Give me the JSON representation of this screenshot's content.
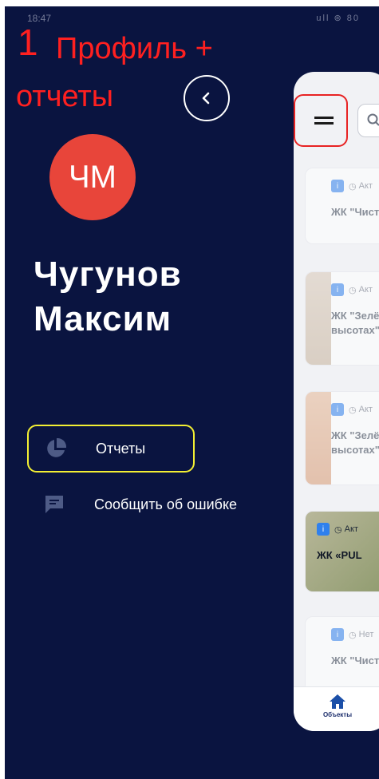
{
  "status_bar": {
    "time": "18:47",
    "icons_text": "ull ⊛ 80"
  },
  "annotation": {
    "number": "1",
    "line1": "Профиль +",
    "line2": "отчеты"
  },
  "profile": {
    "initials": "ЧМ",
    "name": "Чугунов Максим",
    "avatar_color": "#e8453a"
  },
  "menu": {
    "reports_label": "Отчеты",
    "report_bug_label": "Сообщить об ошибке"
  },
  "panel": {
    "cards": [
      {
        "status": "Акт",
        "title": "ЖК \"Чист"
      },
      {
        "status": "Акт",
        "title": "ЖК \"Зелё",
        "title2": "высотах\""
      },
      {
        "status": "Акт",
        "title": "ЖК \"Зелё",
        "title2": "высотах\""
      },
      {
        "status": "Акт",
        "title": "ЖК «PUL"
      },
      {
        "status": "Нет",
        "title": "ЖК \"Чист"
      }
    ],
    "tab_objects_label": "Объекты"
  },
  "colors": {
    "background": "#0a1440",
    "accent": "#2f80ed",
    "highlight_red": "#e82323",
    "highlight_yellow": "#f3ef33"
  }
}
